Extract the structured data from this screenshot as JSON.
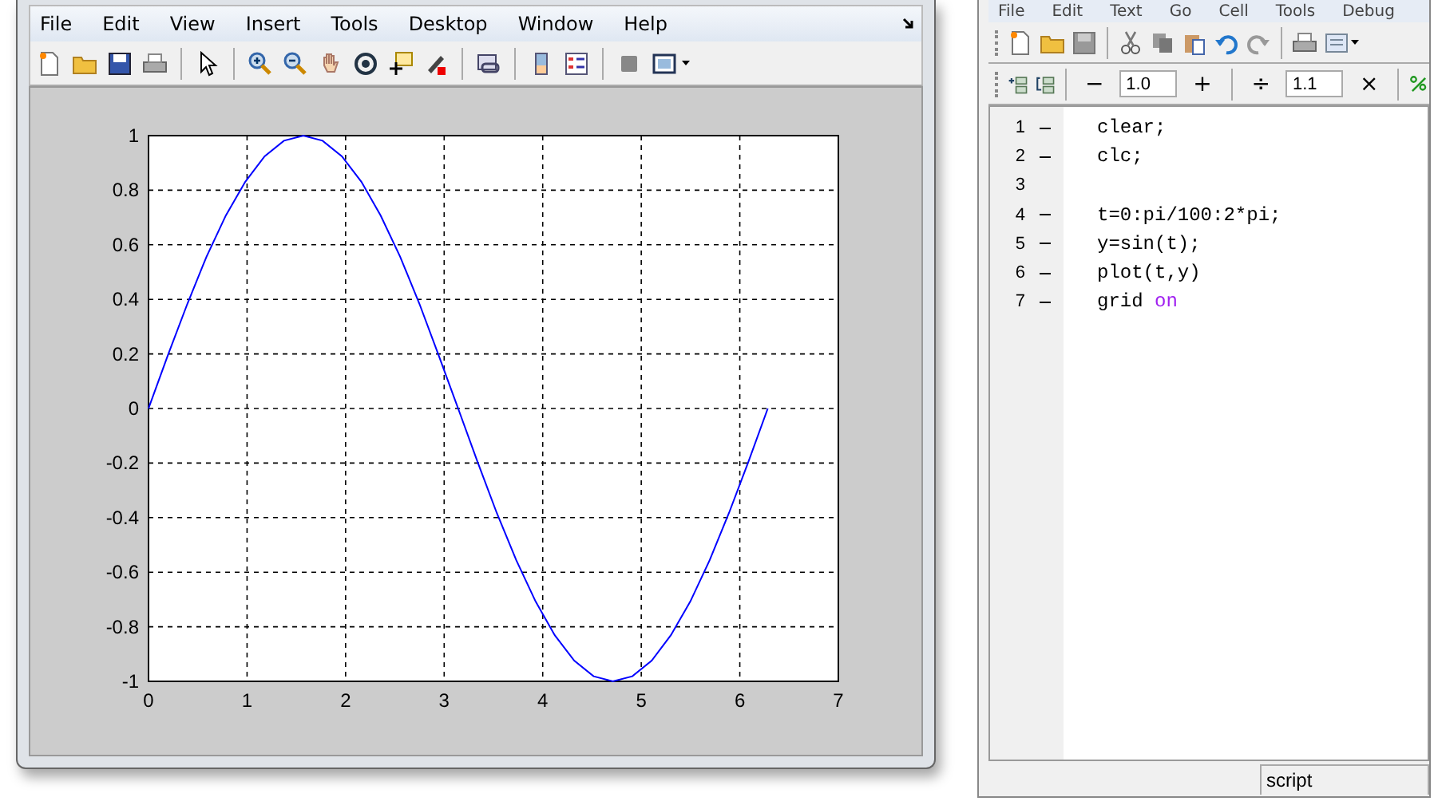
{
  "figure_window": {
    "menu": [
      "File",
      "Edit",
      "View",
      "Insert",
      "Tools",
      "Desktop",
      "Window",
      "Help"
    ],
    "chart_data": {
      "type": "line",
      "x": [
        0,
        0.196,
        0.393,
        0.589,
        0.785,
        0.982,
        1.178,
        1.374,
        1.571,
        1.767,
        1.963,
        2.16,
        2.356,
        2.553,
        2.749,
        2.945,
        3.142,
        3.338,
        3.534,
        3.731,
        3.927,
        4.123,
        4.32,
        4.516,
        4.712,
        4.909,
        5.105,
        5.301,
        5.498,
        5.694,
        5.89,
        6.087,
        6.283
      ],
      "grid": true,
      "series": [
        {
          "color": "#0000ff",
          "values": [
            0,
            0.195,
            0.383,
            0.556,
            0.707,
            0.831,
            0.924,
            0.981,
            1,
            0.981,
            0.924,
            0.831,
            0.707,
            0.556,
            0.383,
            0.195,
            0,
            -0.195,
            -0.383,
            -0.556,
            -0.707,
            -0.831,
            -0.924,
            -0.981,
            -1,
            -0.981,
            -0.924,
            -0.831,
            -0.707,
            -0.556,
            -0.383,
            -0.195,
            0
          ]
        }
      ],
      "xlim": [
        0,
        7
      ],
      "ylim": [
        -1,
        1
      ],
      "xticks": [
        0,
        1,
        2,
        3,
        4,
        5,
        6,
        7
      ],
      "yticks": [
        {
          "value": -1,
          "label": "-1"
        },
        {
          "value": -0.8,
          "label": "-0.8"
        },
        {
          "value": -0.6,
          "label": "-0.6"
        },
        {
          "value": -0.4,
          "label": "-0.4"
        },
        {
          "value": -0.2,
          "label": "-0.2"
        },
        {
          "value": 0,
          "label": "0"
        },
        {
          "value": 0.2,
          "label": "0.2"
        },
        {
          "value": 0.4,
          "label": "0.4"
        },
        {
          "value": 0.6,
          "label": "0.6"
        },
        {
          "value": 0.8,
          "label": "0.8"
        },
        {
          "value": 1,
          "label": "1"
        }
      ]
    }
  },
  "editor_window": {
    "menu": [
      "File",
      "Edit",
      "Text",
      "Go",
      "Cell",
      "Tools",
      "Debug"
    ],
    "cell_toolbar": {
      "minus": "−",
      "first_value": "1.0",
      "plus": "+",
      "divide": "÷",
      "second_value": "1.1",
      "times": "×"
    },
    "lines": [
      {
        "number": "1",
        "executable": true,
        "segments": [
          {
            "text": "clear;",
            "kind": "plain"
          }
        ]
      },
      {
        "number": "2",
        "executable": true,
        "segments": [
          {
            "text": "clc;",
            "kind": "plain"
          }
        ]
      },
      {
        "number": "3",
        "executable": false
      },
      {
        "number": "4",
        "executable": true,
        "segments": [
          {
            "text": "t=0:pi/100:2*pi;",
            "kind": "plain"
          }
        ]
      },
      {
        "number": "5",
        "executable": true,
        "segments": [
          {
            "text": "y=sin(t);",
            "kind": "plain"
          }
        ]
      },
      {
        "number": "6",
        "executable": true,
        "segments": [
          {
            "text": "plot(t,y)",
            "kind": "plain"
          }
        ]
      },
      {
        "number": "7",
        "executable": true,
        "segments": [
          {
            "text": "grid ",
            "kind": "plain"
          },
          {
            "text": "on",
            "kind": "string"
          }
        ]
      }
    ],
    "status": "script"
  }
}
